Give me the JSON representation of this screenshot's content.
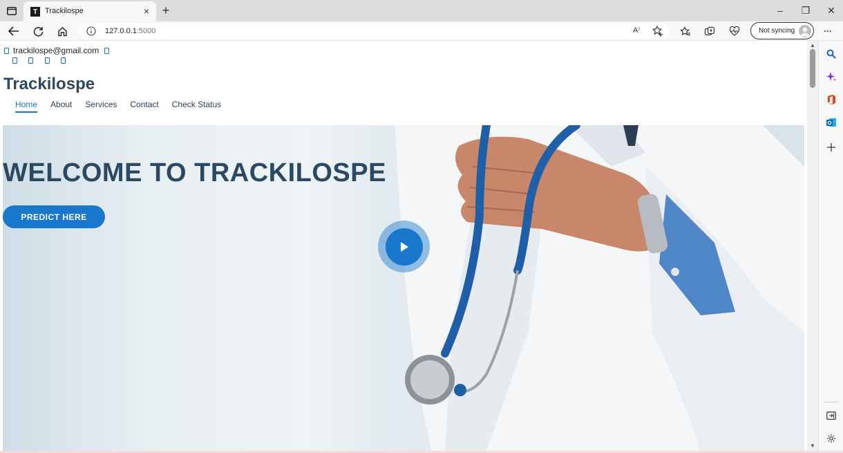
{
  "browser": {
    "tab": {
      "favicon_letter": "T",
      "title": "Trackilospe",
      "close_glyph": "×"
    },
    "newtab_glyph": "+",
    "window_controls": {
      "minimize": "–",
      "restore": "❐",
      "close": "✕"
    },
    "address": {
      "host": "127.0.0.1",
      "port": ":5000"
    },
    "read_aloud_glyph": "A⁾",
    "sync": {
      "label": "Not syncing"
    },
    "more_glyph": "···"
  },
  "site": {
    "topbar": {
      "email": "trackilospe@gmail.com"
    },
    "brand": "Trackilospe",
    "nav": [
      {
        "label": "Home",
        "active": true
      },
      {
        "label": "About"
      },
      {
        "label": "Services"
      },
      {
        "label": "Contact"
      },
      {
        "label": "Check Status"
      }
    ],
    "hero": {
      "title": "WELCOME TO TRACKILOSPE",
      "cta": "PREDICT HERE"
    }
  },
  "colors": {
    "accent": "#1977cc",
    "heading": "#2c4964"
  },
  "icons": [
    "sidebar-toggle-icon",
    "back-icon",
    "refresh-icon",
    "home-icon",
    "info-icon",
    "add-favorite-icon",
    "favorites-icon",
    "collections-icon",
    "browser-essentials-icon",
    "search-icon",
    "copilot-icon",
    "office-icon",
    "outlook-icon",
    "add-icon",
    "split-screen-icon",
    "settings-icon",
    "play-icon"
  ]
}
